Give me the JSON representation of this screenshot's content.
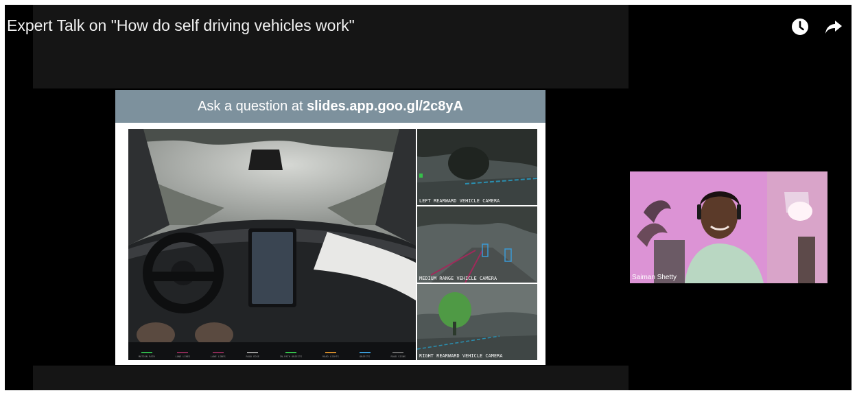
{
  "video": {
    "title": "Expert Talk on \"How do self driving vehicles work\"",
    "watch_later_icon": "clock-icon",
    "share_icon": "share-arrow-icon"
  },
  "slide": {
    "header_prefix": "Ask a question at ",
    "header_link": "slides.app.goo.gl/2c8yA",
    "cameras": [
      {
        "label": "LEFT REARWARD VEHICLE CAMERA"
      },
      {
        "label": "MEDIUM RANGE VEHICLE CAMERA"
      },
      {
        "label": "RIGHT REARWARD VEHICLE CAMERA"
      }
    ],
    "status_strip": [
      {
        "label": "MOTION PATH",
        "color": "#2fb34a"
      },
      {
        "label": "LANE LINES",
        "color": "#8a2a55"
      },
      {
        "label": "LANE LINES",
        "color": "#8a2a55"
      },
      {
        "label": "ROAD EDGE",
        "color": "#9a9a9a"
      },
      {
        "label": "IN-PATH OBJECTS",
        "color": "#35c04a"
      },
      {
        "label": "ROAD LIGHTS",
        "color": "#d08a2a"
      },
      {
        "label": "OBJECTS",
        "color": "#3a9ad6"
      },
      {
        "label": "ROAD SIGNS",
        "color": "#6a6a6a"
      }
    ]
  },
  "participant": {
    "name": "Saiman Shetty"
  },
  "colors": {
    "background": "#000000",
    "slide_header": "#7d919d",
    "title_text": "#f1f1f1"
  }
}
